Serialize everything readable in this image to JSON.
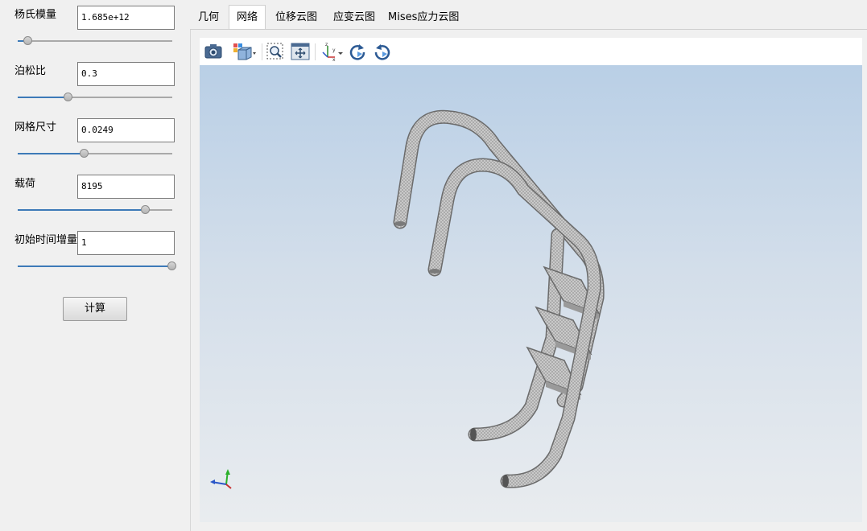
{
  "params": [
    {
      "label": "杨氏模量",
      "value": "1.685e+12",
      "slider_fraction": 0.07
    },
    {
      "label": "泊松比",
      "value": "0.3",
      "slider_fraction": 0.33
    },
    {
      "label": "网格尺寸",
      "value": "0.0249",
      "slider_fraction": 0.43
    },
    {
      "label": "载荷",
      "value": "8195",
      "slider_fraction": 0.83
    },
    {
      "label": "初始时间增量",
      "value": "1",
      "slider_fraction": 1.0
    }
  ],
  "calc_button": "计算",
  "tabs": [
    {
      "label": "几何",
      "active": false
    },
    {
      "label": "网络",
      "active": true
    },
    {
      "label": "位移云图",
      "active": false
    },
    {
      "label": "应变云图",
      "active": false
    },
    {
      "label": "Mises应力云图",
      "active": false
    }
  ],
  "toolbar_icons": [
    "camera-icon",
    "view-cube-icon",
    "zoom-box-icon",
    "fit-all-icon",
    "axis-orientation-icon",
    "rotate-cw-icon",
    "rotate-ccw-icon"
  ],
  "axis_triad_icon": "xyz-axes-icon",
  "colors": {
    "slider_fill": "#3d7ab8",
    "mesh": "#c6c6c6",
    "background_top": "#b9cfe6",
    "background_bottom": "#e9ecef"
  }
}
